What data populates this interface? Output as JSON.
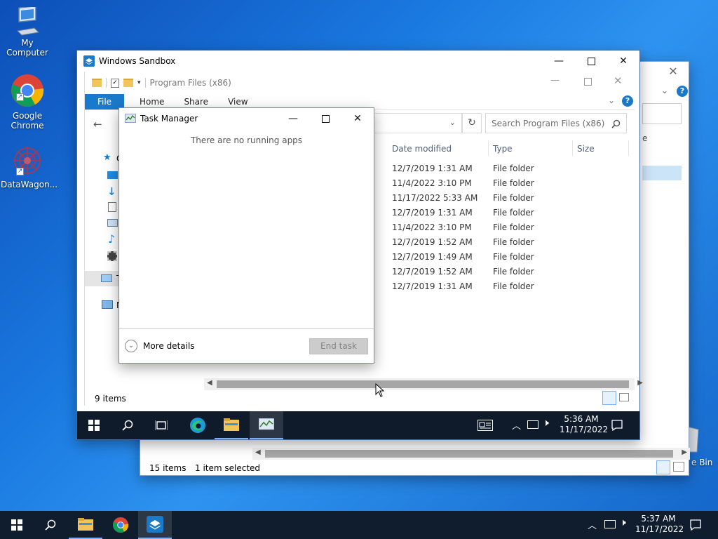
{
  "desktop": {
    "icons": [
      {
        "label": "My Computer",
        "icon": "computer-icon"
      },
      {
        "label": "Google Chrome",
        "line1": "Google",
        "line2": "Chrome",
        "icon": "chrome-icon"
      },
      {
        "label": "DataWagon...",
        "icon": "datawagon-icon"
      },
      {
        "label": "e Bin",
        "icon": "recycle-bin-icon"
      }
    ]
  },
  "back_explorer": {
    "status_items": "15 items",
    "status_selected": "1 item selected",
    "col_fragment": "e"
  },
  "sandbox": {
    "title": "Windows Sandbox"
  },
  "explorer": {
    "path_label": "Program Files (x86)",
    "tabs": [
      "File",
      "Home",
      "Share",
      "View"
    ],
    "search_placeholder": "Search Program Files (x86)",
    "columns": {
      "date": "Date modified",
      "type": "Type",
      "size": "Size"
    },
    "rows": [
      {
        "date": "12/7/2019 1:31 AM",
        "type": "File folder"
      },
      {
        "date": "11/4/2022 3:10 PM",
        "type": "File folder"
      },
      {
        "date": "11/17/2022 5:33 AM",
        "type": "File folder"
      },
      {
        "date": "12/7/2019 1:31 AM",
        "type": "File folder"
      },
      {
        "date": "11/4/2022 3:10 PM",
        "type": "File folder"
      },
      {
        "date": "12/7/2019 1:52 AM",
        "type": "File folder"
      },
      {
        "date": "12/7/2019 1:49 AM",
        "type": "File folder"
      },
      {
        "date": "12/7/2019 1:52 AM",
        "type": "File folder"
      },
      {
        "date": "12/7/2019 1:31 AM",
        "type": "File folder"
      }
    ],
    "nav_letters": [
      "Q",
      "T",
      "N"
    ],
    "status_items": "9 items"
  },
  "task_manager": {
    "title": "Task Manager",
    "empty_message": "There are no running apps",
    "more_details": "More details",
    "end_task": "End task"
  },
  "sandbox_taskbar": {
    "time": "5:36 AM",
    "date": "11/17/2022"
  },
  "host_taskbar": {
    "time": "5:37 AM",
    "date": "11/17/2022"
  },
  "colors": {
    "accent": "#1979ca",
    "taskbar": "#0f1b2b"
  }
}
